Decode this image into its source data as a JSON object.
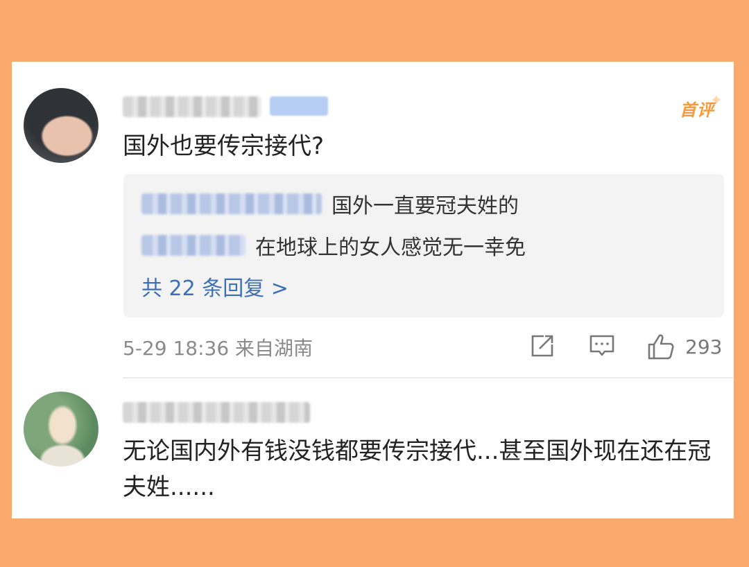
{
  "comments": [
    {
      "text": "国外也要传宗接代?",
      "first_badge": "首评",
      "replies": [
        {
          "text": "国外一直要冠夫姓的"
        },
        {
          "text": "在地球上的女人感觉无一幸免"
        }
      ],
      "reply_summary": "共 22 条回复 >",
      "meta": "5-29 18:36 来自湖南",
      "like_count": "293"
    },
    {
      "text": "无论国内外有钱没钱都要传宗接代...甚至国外现在还在冠夫姓......"
    }
  ],
  "colors": {
    "background": "#f8a96b",
    "link": "#3d6fb6",
    "badge": "#f39a3c"
  },
  "icons": [
    "share-icon",
    "comment-icon",
    "like-icon",
    "star-icon"
  ]
}
